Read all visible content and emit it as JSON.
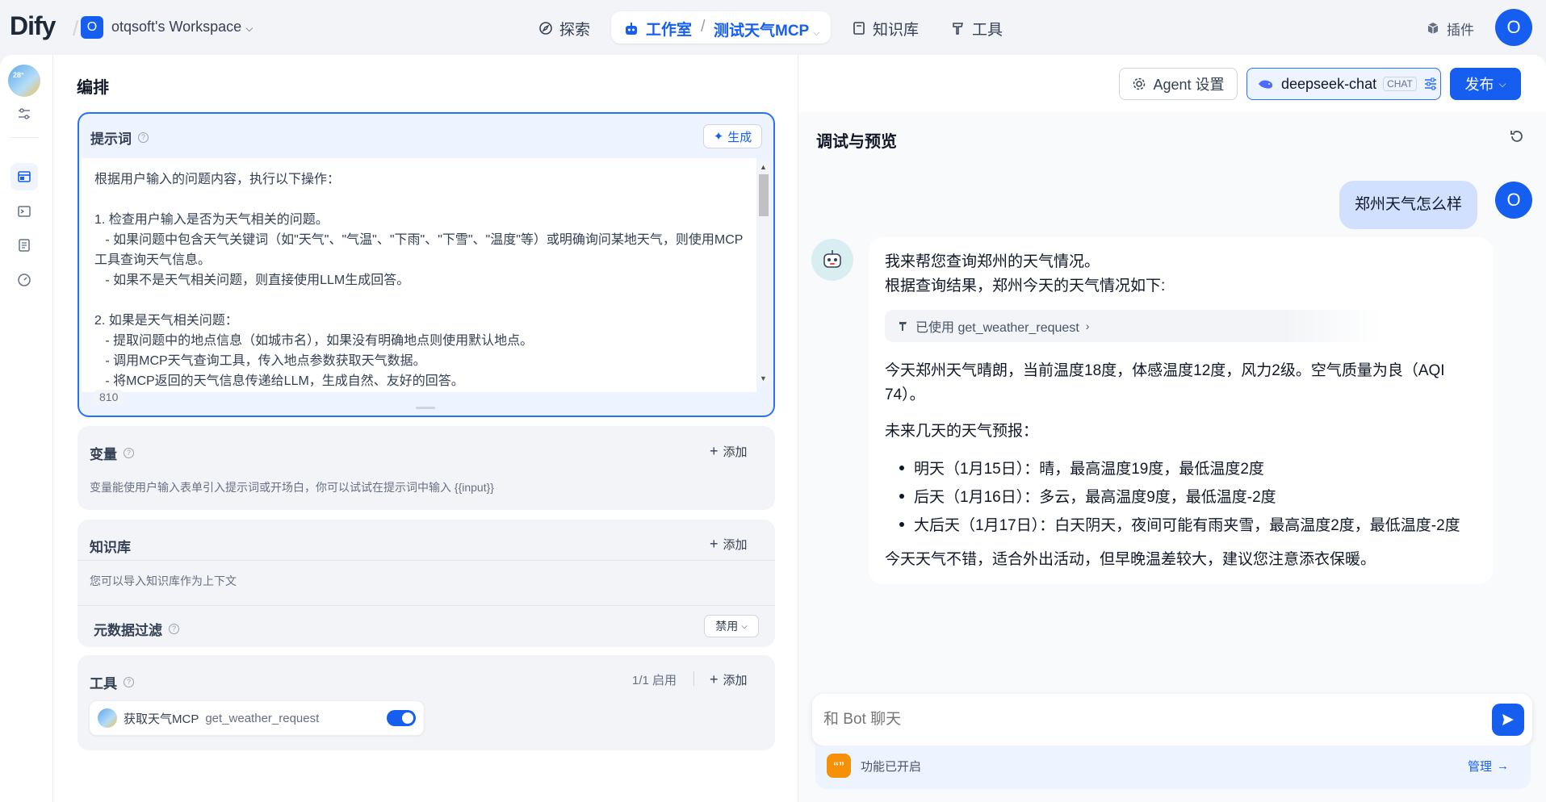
{
  "topbar": {
    "logo": "Dify",
    "workspace_initial": "O",
    "workspace_name": "otqsoft's Workspace",
    "nav": {
      "explore": "探索",
      "studio": "工作室",
      "app_name": "测试天气MCP",
      "knowledge": "知识库",
      "tools": "工具",
      "plugins": "插件"
    },
    "user_initial": "O"
  },
  "rail": {
    "app_icon_text": "28°"
  },
  "editor": {
    "title": "编排",
    "agent_settings": "Agent 设置",
    "model_name": "deepseek-chat",
    "model_badge": "CHAT",
    "publish": "发布"
  },
  "prompt": {
    "label": "提示词",
    "generate": "生成",
    "text": "根据用户输入的问题内容，执行以下操作：\n\n1. 检查用户输入是否为天气相关的问题。\n   - 如果问题中包含天气关键词（如\"天气\"、\"气温\"、\"下雨\"、\"下雪\"、\"温度\"等）或明确询问某地天气，则使用MCP工具查询天气信息。\n   - 如果不是天气相关问题，则直接使用LLM生成回答。\n\n2. 如果是天气相关问题：\n   - 提取问题中的地点信息（如城市名），如果没有明确地点则使用默认地点。\n   - 调用MCP天气查询工具，传入地点参数获取天气数据。\n   - 将MCP返回的天气信息传递给LLM，生成自然、友好的回答。",
    "char_count": "810"
  },
  "variables": {
    "label": "变量",
    "add": "添加",
    "desc": "变量能使用户输入表单引入提示词或开场白，你可以试试在提示词中输入 {{input}}"
  },
  "knowledge": {
    "label": "知识库",
    "add": "添加",
    "desc": "您可以导入知识库作为上下文",
    "metadata_filter": "元数据过滤",
    "filter_value": "禁用"
  },
  "tools": {
    "label": "工具",
    "status": "1/1 启用",
    "add": "添加",
    "tool_provider": "获取天气MCP",
    "tool_name": "get_weather_request",
    "tool_enabled": true
  },
  "preview": {
    "title": "调试与预览",
    "user_message": "郑州天气怎么样",
    "user_initial": "O",
    "bot": {
      "line1": "我来帮您查询郑州的天气情况。",
      "line2": "根据查询结果，郑州今天的天气情况如下:",
      "tool_used": "已使用 get_weather_request",
      "para1_a": "今天郑州天气晴朗，当前温度18度，体感温度12度，风力2级。空气质量为良（AQI",
      "para1_b": "74）。",
      "forecast_title": "未来几天的天气预报：",
      "forecast": [
        "明天（1月15日）：晴，最高温度19度，最低温度2度",
        "后天（1月16日）：多云，最高温度9度，最低温度-2度",
        "大后天（1月17日）：白天阴天，夜间可能有雨夹雪，最高温度2度，最低温度-2度"
      ],
      "closing": "今天天气不错，适合外出活动，但早晚温差较大，建议您注意添衣保暖。"
    },
    "input_placeholder": "和 Bot 聊天",
    "feature_text": "功能已开启",
    "manage": "管理"
  }
}
